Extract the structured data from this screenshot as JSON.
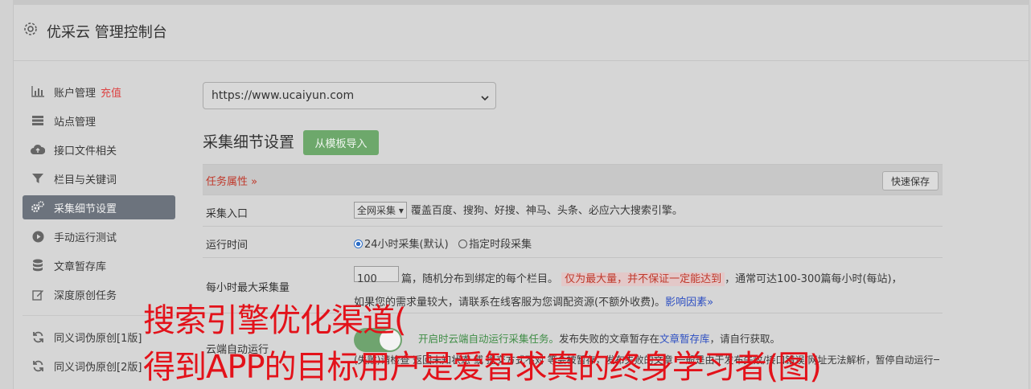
{
  "header": {
    "title": "优采云 管理控制台",
    "icon": "gear-icon"
  },
  "sidebar": {
    "items": [
      {
        "label": "账户管理",
        "extra": "充值",
        "icon": "bar-chart-icon"
      },
      {
        "label": "站点管理",
        "icon": "server-icon"
      },
      {
        "label": "接口文件相关",
        "icon": "cloud-upload-icon"
      },
      {
        "label": "栏目与关键词",
        "icon": "filter-icon"
      },
      {
        "label": "采集细节设置",
        "icon": "gears-icon",
        "active": true
      },
      {
        "label": "手动运行测试",
        "icon": "play-icon"
      },
      {
        "label": "文章暂存库",
        "icon": "database-icon"
      },
      {
        "label": "深度原创任务",
        "icon": "edit-icon"
      },
      {
        "label": "同义词伪原创[1版]",
        "icon": "refresh-icon"
      },
      {
        "label": "同义词伪原创[2版]",
        "icon": "refresh-icon"
      }
    ]
  },
  "main": {
    "site_select": "https://www.ucaiyun.com",
    "section_title": "采集细节设置",
    "import_button": "从模板导入",
    "task_props": "任务属性 »",
    "quick_save": "快速保存",
    "rows": {
      "entry": {
        "label": "采集入口",
        "select": "全网采集",
        "desc": "覆盖百度、搜狗、好搜、神马、头条、必应六大搜索引擎。"
      },
      "runtime": {
        "label": "运行时间",
        "opt1": "24小时采集(默认)",
        "opt2": "指定时段采集"
      },
      "max": {
        "label": "每小时最大采集量",
        "value": "100",
        "text1": "篇，随机分布到绑定的每个栏目。",
        "warn": "仅为最大量，并不保证一定能达到",
        "text2": "，通常可达100-300篇每小时(每站)，",
        "text3": "如果您的需求量较大，请联系在线客服为您调配资源(不额外收费)。",
        "link": "影响因素»"
      },
      "cloud": {
        "label": "云端自动运行",
        "text1": "开启时云端自动运行采集任务。",
        "text2": "发布失败的文章暂存在",
        "link": "文章暂存库",
        "text3": "，请自行获取。",
        "text4": "(失败)请检查 返回未知状态 或 提交方式不对 等会被暂存，发布失败的文章 一般是由于发布失败/接口错误/网址无法解析，暂停自动运行一定时间通知我。"
      }
    }
  },
  "overlay": {
    "line1": "搜索引擎优化渠道(",
    "line2": "得到APP的目标用户是爱智求真的终身学习者(图)"
  },
  "colors": {
    "accent_green": "#6da86b",
    "warn_red": "#c0392b",
    "link_blue": "#2d4fc2",
    "active_bg": "#6c737d"
  }
}
